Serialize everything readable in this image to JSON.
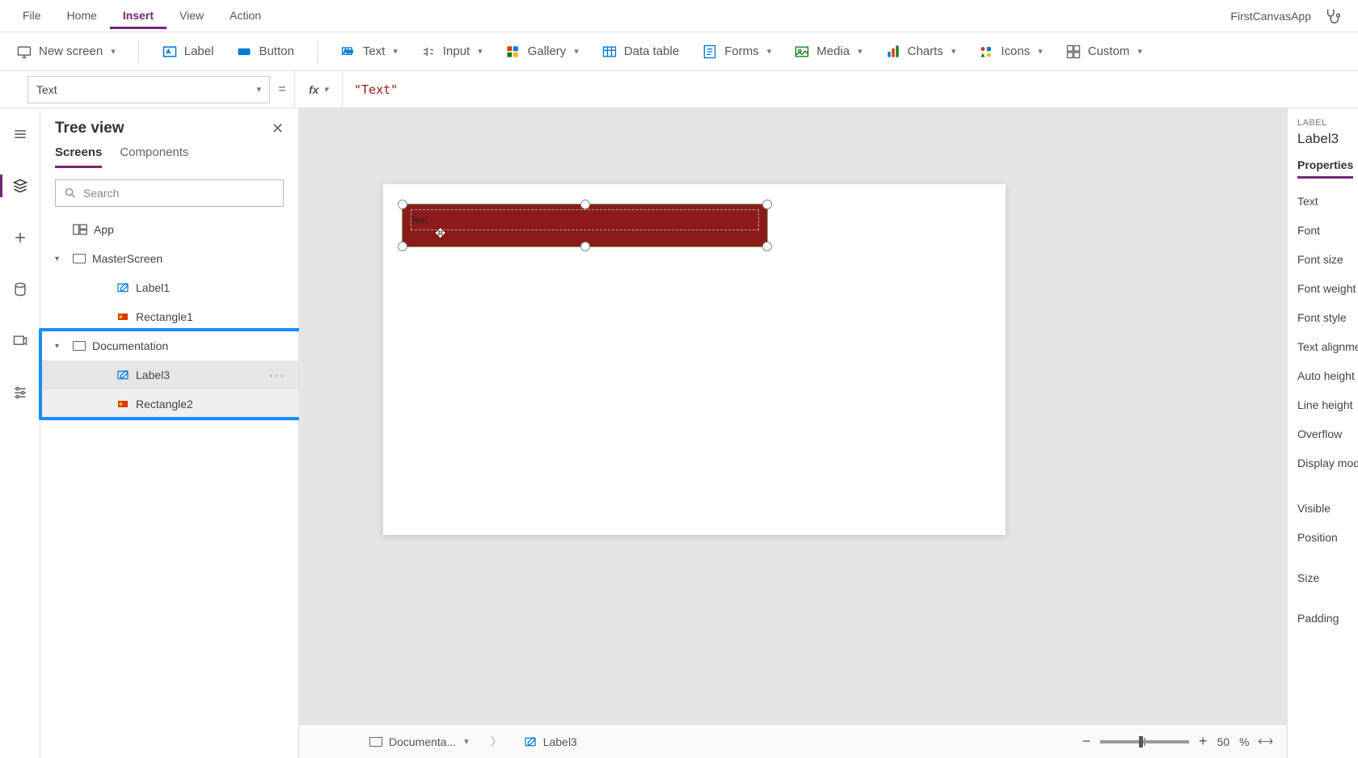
{
  "menubar": {
    "items": [
      "File",
      "Home",
      "Insert",
      "View",
      "Action"
    ],
    "active": "Insert",
    "appName": "FirstCanvasApp"
  },
  "ribbon": {
    "newScreen": "New screen",
    "label": "Label",
    "button": "Button",
    "text": "Text",
    "input": "Input",
    "gallery": "Gallery",
    "dataTable": "Data table",
    "forms": "Forms",
    "media": "Media",
    "charts": "Charts",
    "icons": "Icons",
    "custom": "Custom"
  },
  "formula": {
    "property": "Text",
    "fx": "fx",
    "value": "\"Text\""
  },
  "treeview": {
    "title": "Tree view",
    "tabs": {
      "screens": "Screens",
      "components": "Components"
    },
    "searchPlaceholder": "Search",
    "app": "App",
    "rows": {
      "masterScreen": "MasterScreen",
      "label1": "Label1",
      "rectangle1": "Rectangle1",
      "documentation": "Documentation",
      "label3": "Label3",
      "rectangle2": "Rectangle2"
    }
  },
  "canvas": {
    "selectedText": "Text"
  },
  "statusbar": {
    "breadcrumbScreen": "Documenta...",
    "breadcrumbControl": "Label3",
    "zoomValue": "50",
    "zoomUnit": "%"
  },
  "properties": {
    "type": "LABEL",
    "name": "Label3",
    "tab": "Properties",
    "fields": [
      "Text",
      "Font",
      "Font size",
      "Font weight",
      "Font style",
      "Text alignment",
      "Auto height",
      "Line height",
      "Overflow",
      "Display mode",
      "Visible",
      "Position",
      "Size",
      "Padding"
    ]
  }
}
